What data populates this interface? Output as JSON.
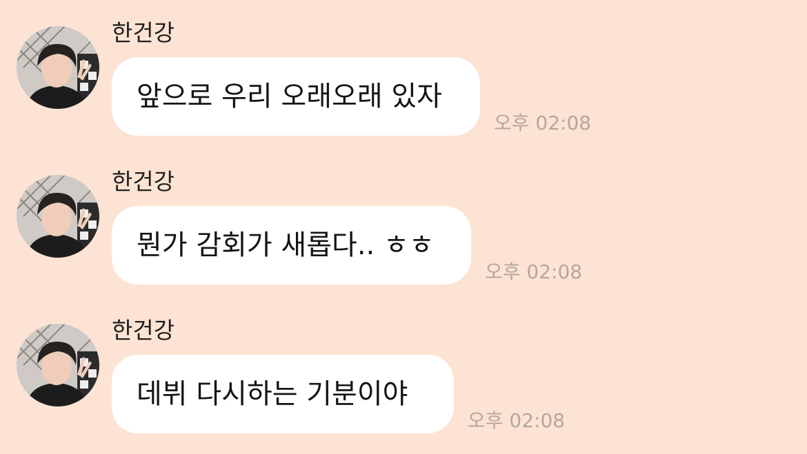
{
  "messages": [
    {
      "sender": "한건강",
      "text": "앞으로 우리 오래오래 있자",
      "time": "오후 02:08"
    },
    {
      "sender": "한건강",
      "text": "뭔가 감회가 새롭다.. ㅎㅎ",
      "time": "오후 02:08"
    },
    {
      "sender": "한건강",
      "text": "데뷔 다시하는 기분이야",
      "time": "오후 02:08"
    }
  ],
  "colors": {
    "background": "#fde3d4",
    "bubble": "#ffffff",
    "timestamp": "#b3a79f"
  },
  "icons": {
    "avatar": "profile-photo"
  }
}
